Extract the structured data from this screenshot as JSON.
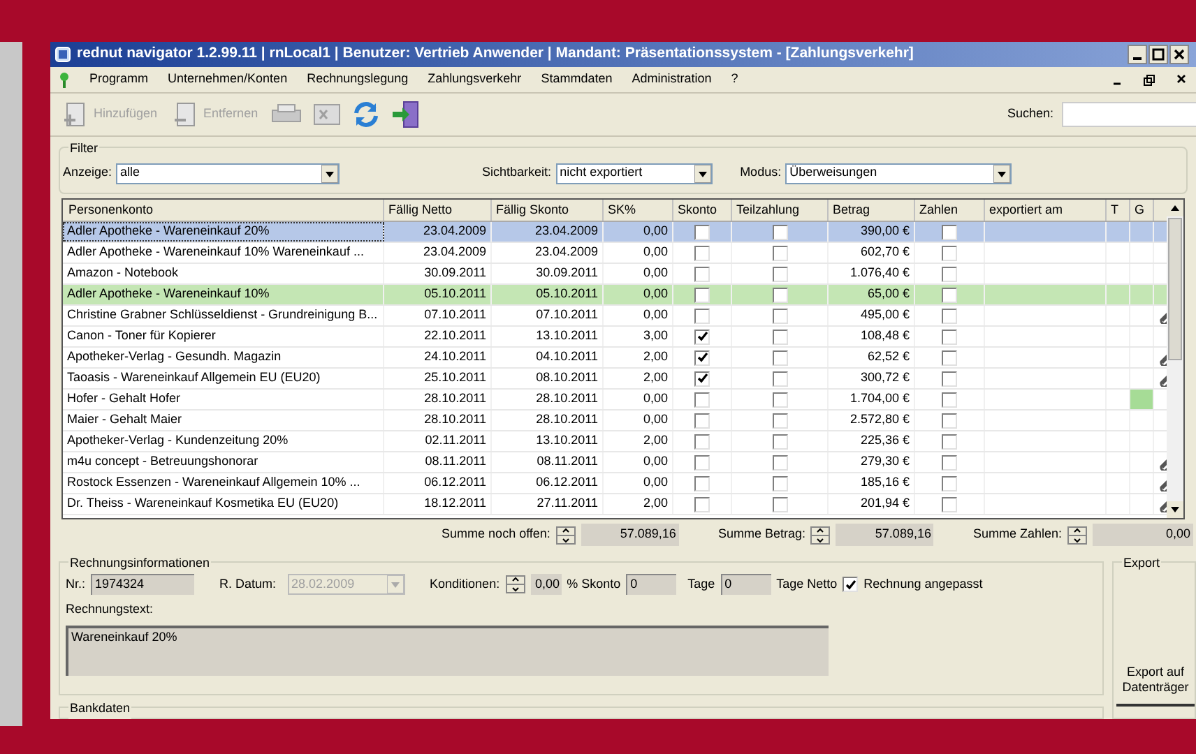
{
  "window": {
    "title": "rednut navigator 1.2.99.11  | rnLocal1  | Benutzer: Vertrieb Anwender | Mandant: Präsentationssystem - [Zahlungsverkehr]"
  },
  "menu": [
    {
      "label": "Programm"
    },
    {
      "label": "Unternehmen/Konten"
    },
    {
      "label": "Rechnungslegung"
    },
    {
      "label": "Zahlungsverkehr"
    },
    {
      "label": "Stammdaten"
    },
    {
      "label": "Administration"
    },
    {
      "label": "?"
    }
  ],
  "toolbar": {
    "buttons": [
      {
        "label": "Hinzufügen",
        "disabled": true
      },
      {
        "label": "Entfernen",
        "disabled": true
      }
    ],
    "search_label": "Suchen:"
  },
  "filter": {
    "title": "Filter",
    "fields": [
      {
        "label": "Anzeige:",
        "value": "alle"
      },
      {
        "label": "Sichtbarkeit:",
        "value": "nicht exportiert"
      },
      {
        "label": "Modus:",
        "value": "Überweisungen"
      }
    ]
  },
  "table": {
    "columns": [
      "Personenkonto",
      "Fällig Netto",
      "Fällig Skonto",
      "SK%",
      "Skonto",
      "Teilzahlung",
      "Betrag",
      "Zahlen",
      "exportiert am",
      "T",
      "G"
    ],
    "rows": [
      {
        "account": "Adler Apotheke - Wareneinkauf 20%",
        "netto": "23.04.2009",
        "skonto_date": "23.04.2009",
        "sk": "0,00",
        "skonto": false,
        "teilzahlung": false,
        "betrag": "390,00 €",
        "zahlen": false,
        "selected": true,
        "highlighted": false,
        "g_marked": false,
        "attachment": false
      },
      {
        "account": "Adler Apotheke - Wareneinkauf 10% Wareneinkauf ...",
        "netto": "23.04.2009",
        "skonto_date": "23.04.2009",
        "sk": "0,00",
        "skonto": false,
        "teilzahlung": false,
        "betrag": "602,70 €",
        "zahlen": false,
        "selected": false,
        "highlighted": false,
        "g_marked": false,
        "attachment": false
      },
      {
        "account": "Amazon - Notebook",
        "netto": "30.09.2011",
        "skonto_date": "30.09.2011",
        "sk": "0,00",
        "skonto": false,
        "teilzahlung": false,
        "betrag": "1.076,40 €",
        "zahlen": false,
        "selected": false,
        "highlighted": false,
        "g_marked": false,
        "attachment": false
      },
      {
        "account": "Adler Apotheke - Wareneinkauf 10%",
        "netto": "05.10.2011",
        "skonto_date": "05.10.2011",
        "sk": "0,00",
        "skonto": false,
        "teilzahlung": false,
        "betrag": "65,00 €",
        "zahlen": false,
        "selected": false,
        "highlighted": true,
        "g_marked": false,
        "attachment": false
      },
      {
        "account": "Christine Grabner Schlüsseldienst - Grundreinigung B...",
        "netto": "07.10.2011",
        "skonto_date": "07.10.2011",
        "sk": "0,00",
        "skonto": false,
        "teilzahlung": false,
        "betrag": "495,00 €",
        "zahlen": false,
        "selected": false,
        "highlighted": false,
        "g_marked": false,
        "attachment": true
      },
      {
        "account": "Canon - Toner für Kopierer",
        "netto": "22.10.2011",
        "skonto_date": "13.10.2011",
        "sk": "3,00",
        "skonto": true,
        "teilzahlung": false,
        "betrag": "108,48 €",
        "zahlen": false,
        "selected": false,
        "highlighted": false,
        "g_marked": false,
        "attachment": false
      },
      {
        "account": "Apotheker-Verlag - Gesundh. Magazin",
        "netto": "24.10.2011",
        "skonto_date": "04.10.2011",
        "sk": "2,00",
        "skonto": true,
        "teilzahlung": false,
        "betrag": "62,52 €",
        "zahlen": false,
        "selected": false,
        "highlighted": false,
        "g_marked": false,
        "attachment": true
      },
      {
        "account": "Taoasis - Wareneinkauf Allgemein EU (EU20)",
        "netto": "25.10.2011",
        "skonto_date": "08.10.2011",
        "sk": "2,00",
        "skonto": true,
        "teilzahlung": false,
        "betrag": "300,72 €",
        "zahlen": false,
        "selected": false,
        "highlighted": false,
        "g_marked": false,
        "attachment": true
      },
      {
        "account": "Hofer - Gehalt Hofer",
        "netto": "28.10.2011",
        "skonto_date": "28.10.2011",
        "sk": "0,00",
        "skonto": false,
        "teilzahlung": false,
        "betrag": "1.704,00 €",
        "zahlen": false,
        "selected": false,
        "highlighted": false,
        "g_marked": true,
        "attachment": false
      },
      {
        "account": "Maier - Gehalt Maier",
        "netto": "28.10.2011",
        "skonto_date": "28.10.2011",
        "sk": "0,00",
        "skonto": false,
        "teilzahlung": false,
        "betrag": "2.572,80 €",
        "zahlen": false,
        "selected": false,
        "highlighted": false,
        "g_marked": false,
        "attachment": false
      },
      {
        "account": "Apotheker-Verlag - Kundenzeitung 20%",
        "netto": "02.11.2011",
        "skonto_date": "13.10.2011",
        "sk": "2,00",
        "skonto": false,
        "teilzahlung": false,
        "betrag": "225,36 €",
        "zahlen": false,
        "selected": false,
        "highlighted": false,
        "g_marked": false,
        "attachment": false
      },
      {
        "account": "m4u concept - Betreuungshonorar",
        "netto": "08.11.2011",
        "skonto_date": "08.11.2011",
        "sk": "0,00",
        "skonto": false,
        "teilzahlung": false,
        "betrag": "279,30 €",
        "zahlen": false,
        "selected": false,
        "highlighted": false,
        "g_marked": false,
        "attachment": true
      },
      {
        "account": "Rostock Essenzen - Wareneinkauf Allgemein 10% ...",
        "netto": "06.12.2011",
        "skonto_date": "06.12.2011",
        "sk": "0,00",
        "skonto": false,
        "teilzahlung": false,
        "betrag": "185,16 €",
        "zahlen": false,
        "selected": false,
        "highlighted": false,
        "g_marked": false,
        "attachment": true
      },
      {
        "account": "Dr. Theiss - Wareneinkauf Kosmetika EU (EU20)",
        "netto": "18.12.2011",
        "skonto_date": "27.11.2011",
        "sk": "2,00",
        "skonto": false,
        "teilzahlung": false,
        "betrag": "201,94 €",
        "zahlen": false,
        "selected": false,
        "highlighted": false,
        "g_marked": false,
        "attachment": true
      }
    ]
  },
  "totals": [
    {
      "label": "Summe noch offen:",
      "value": "57.089,16"
    },
    {
      "label": "Summe Betrag:",
      "value": "57.089,16"
    },
    {
      "label": "Summe Zahlen:",
      "value": "0,00"
    }
  ],
  "invoice": {
    "title": "Rechnungsinformationen",
    "nr_label": "Nr.:",
    "nr": "1974324",
    "date_label": "R. Datum:",
    "date": "28.02.2009",
    "conditions_label": "Konditionen:",
    "conditions": "0,00",
    "skonto_label": "% Skonto",
    "skonto_days": "0",
    "days_label": "Tage",
    "netto_days": "0",
    "netto_label": "Tage Netto",
    "adjusted": {
      "label": "Rechnung angepasst",
      "checked": true
    },
    "text_label": "Rechnungstext:",
    "text": "Wareneinkauf 20%"
  },
  "export": {
    "title": "Export",
    "button": "Export auf Datenträger"
  },
  "bank": {
    "title": "Bankdaten"
  }
}
